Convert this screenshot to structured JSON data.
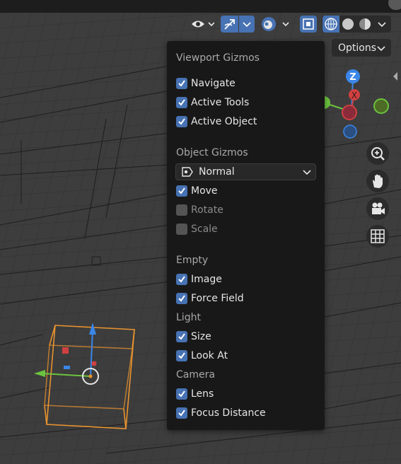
{
  "header": {
    "options_label": "Options",
    "buttons": [
      {
        "name": "visibility-eye-icon"
      },
      {
        "name": "gizmo-toggle-icon"
      },
      {
        "name": "overlays-icon"
      },
      {
        "name": "xray-icon"
      },
      {
        "name": "wireframe-shading-icon"
      },
      {
        "name": "solid-shading-icon"
      },
      {
        "name": "material-shading-icon"
      }
    ]
  },
  "nav_gizmo": {
    "z_label": "Z",
    "x_label": "X"
  },
  "popover": {
    "viewport_gizmos": {
      "title": "Viewport Gizmos",
      "items": [
        {
          "label": "Navigate",
          "checked": true
        },
        {
          "label": "Active Tools",
          "checked": true
        },
        {
          "label": "Active Object",
          "checked": true
        }
      ]
    },
    "object_gizmos": {
      "title": "Object Gizmos",
      "orientation": "Normal",
      "items": [
        {
          "label": "Move",
          "checked": true
        },
        {
          "label": "Rotate",
          "checked": false
        },
        {
          "label": "Scale",
          "checked": false
        }
      ]
    },
    "empty": {
      "title": "Empty",
      "items": [
        {
          "label": "Image",
          "checked": true
        },
        {
          "label": "Force Field",
          "checked": true
        }
      ]
    },
    "light": {
      "title": "Light",
      "items": [
        {
          "label": "Size",
          "checked": true
        },
        {
          "label": "Look At",
          "checked": true
        }
      ]
    },
    "camera": {
      "title": "Camera",
      "items": [
        {
          "label": "Lens",
          "checked": true
        },
        {
          "label": "Focus Distance",
          "checked": true
        }
      ]
    }
  },
  "colors": {
    "accent": "#4772b3",
    "panel": "#181818",
    "object_outline": "#e8932f"
  }
}
